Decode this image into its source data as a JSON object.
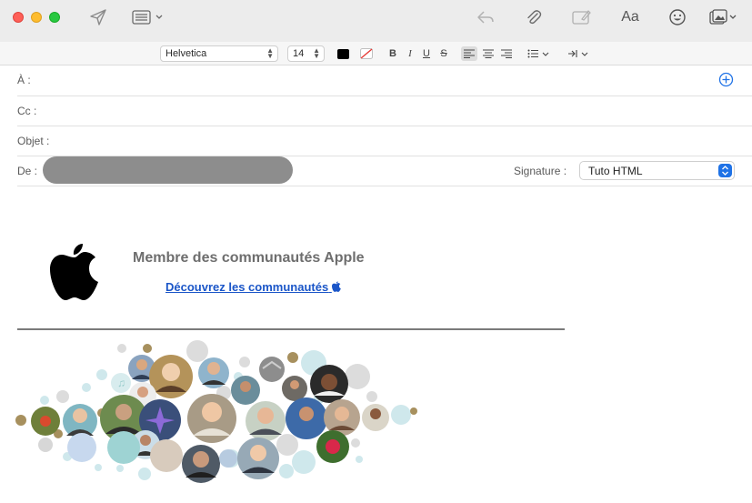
{
  "toolbar": {
    "icons": [
      "send-icon",
      "header-fields-icon",
      "reply-icon",
      "attachment-icon",
      "markup-icon",
      "format-text-icon",
      "emoji-icon",
      "photo-browser-icon"
    ],
    "format_text_label": "Aa"
  },
  "format_bar": {
    "font": "Helvetica",
    "size": "14",
    "bold": "B",
    "italic": "I",
    "underline": "U",
    "strike": "S"
  },
  "fields": {
    "to_label": "À :",
    "cc_label": "Cc :",
    "subject_label": "Objet :",
    "from_label": "De :"
  },
  "signature": {
    "label": "Signature :",
    "selected": "Tuto HTML",
    "title": "Membre des communautés Apple",
    "link": "Découvrez les communautés"
  },
  "colors": {
    "accent": "#1f72e6",
    "link": "#1b56c8"
  }
}
